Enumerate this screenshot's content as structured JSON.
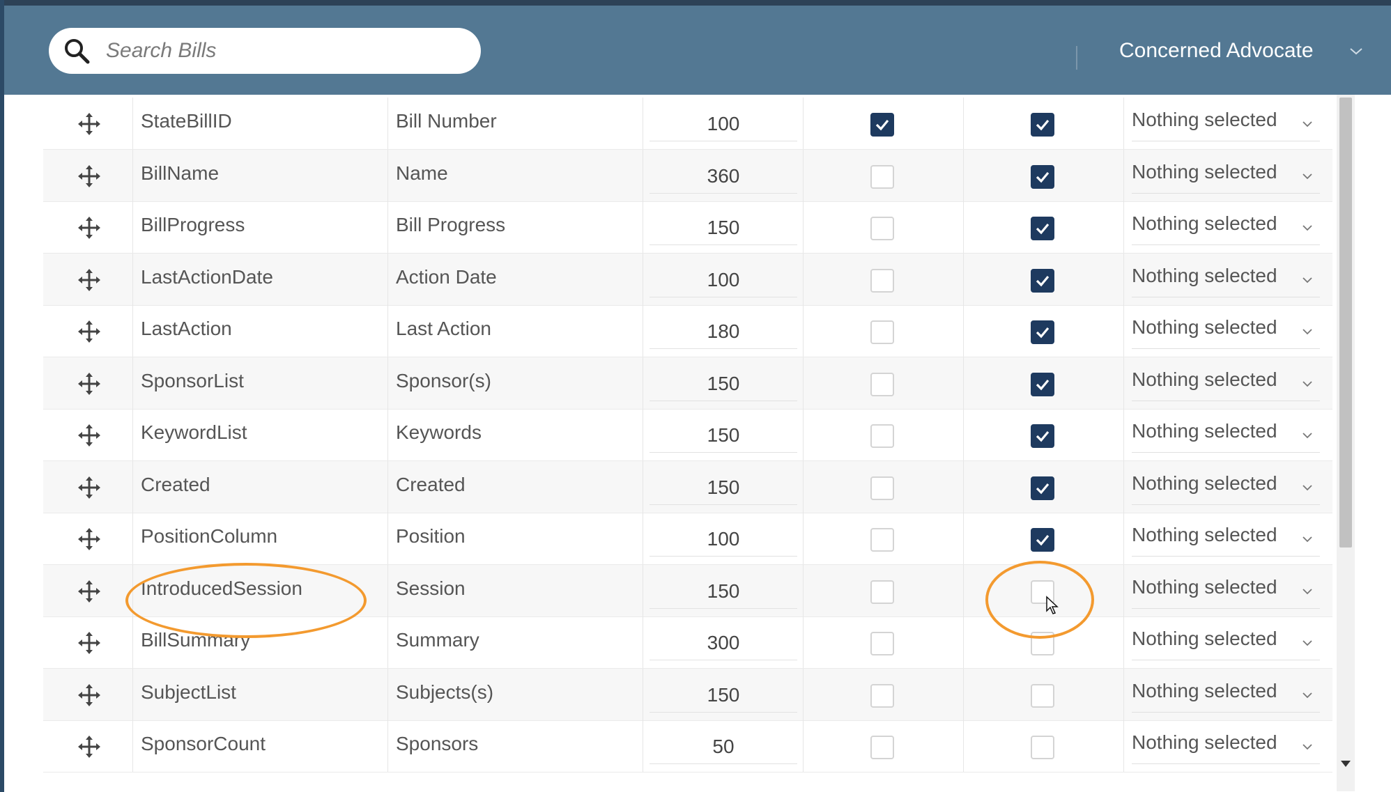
{
  "header": {
    "search_placeholder": "Search Bills",
    "user_name": "Concerned Advocate",
    "icons": {
      "search": "search-icon",
      "user_menu": "chevron-down-icon"
    },
    "colors": {
      "header_bg": "#537893",
      "top_line": "#2d4257"
    }
  },
  "table": {
    "select_default": "Nothing selected",
    "rows": [
      {
        "field": "StateBillID",
        "label": "Bill Number",
        "width": "100",
        "check1": true,
        "check2": true
      },
      {
        "field": "BillName",
        "label": "Name",
        "width": "360",
        "check1": false,
        "check2": true
      },
      {
        "field": "BillProgress",
        "label": "Bill Progress",
        "width": "150",
        "check1": false,
        "check2": true
      },
      {
        "field": "LastActionDate",
        "label": "Action Date",
        "width": "100",
        "check1": false,
        "check2": true
      },
      {
        "field": "LastAction",
        "label": "Last Action",
        "width": "180",
        "check1": false,
        "check2": true
      },
      {
        "field": "SponsorList",
        "label": "Sponsor(s)",
        "width": "150",
        "check1": false,
        "check2": true
      },
      {
        "field": "KeywordList",
        "label": "Keywords",
        "width": "150",
        "check1": false,
        "check2": true
      },
      {
        "field": "Created",
        "label": "Created",
        "width": "150",
        "check1": false,
        "check2": true
      },
      {
        "field": "PositionColumn",
        "label": "Position",
        "width": "100",
        "check1": false,
        "check2": true
      },
      {
        "field": "IntroducedSession",
        "label": "Session",
        "width": "150",
        "check1": false,
        "check2": false
      },
      {
        "field": "BillSummary",
        "label": "Summary",
        "width": "300",
        "check1": false,
        "check2": false
      },
      {
        "field": "SubjectList",
        "label": "Subjects(s)",
        "width": "150",
        "check1": false,
        "check2": false
      },
      {
        "field": "SponsorCount",
        "label": "Sponsors",
        "width": "50",
        "check1": false,
        "check2": false
      }
    ],
    "colors": {
      "checkbox_checked": "#1e3a5f",
      "annotation": "#f39a2f"
    }
  }
}
